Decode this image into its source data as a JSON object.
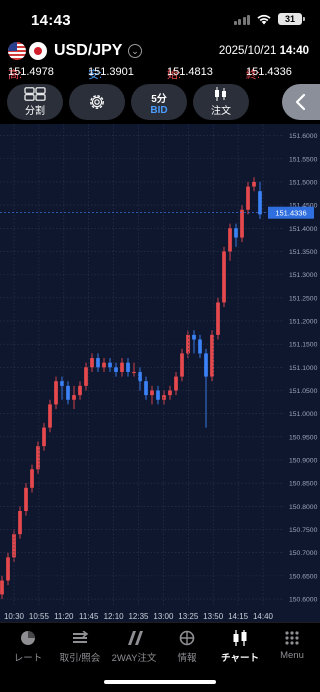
{
  "status": {
    "time": "14:43",
    "battery": "31"
  },
  "pair": {
    "symbol": "USD/JPY",
    "date": "2025/10/21",
    "time": "14:40",
    "high_label": "高:",
    "high": "151.4978",
    "low_label": "安:",
    "low": "151.3901",
    "open_label": "始:",
    "open": "151.4813",
    "close_label": "終:",
    "close": "151.4336"
  },
  "toolbar": {
    "split_label": "分割",
    "interval": "5分",
    "price_side": "BID",
    "order_label": "注文"
  },
  "chart_data": {
    "type": "candlestick",
    "interval": "5分",
    "price_side": "BID",
    "last_price": "151.4336",
    "y_ticks": [
      "151.6000",
      "151.5500",
      "151.5000",
      "151.4500",
      "151.4000",
      "151.3500",
      "151.3000",
      "151.2500",
      "151.2000",
      "151.1500",
      "151.1000",
      "151.0500",
      "151.0000",
      "150.9500",
      "150.9000",
      "150.8500",
      "150.8000",
      "150.7500",
      "150.7000",
      "150.6500",
      "150.6000"
    ],
    "ylim": [
      150.585,
      151.625
    ],
    "x_ticks": [
      "10:30",
      "10:55",
      "11:20",
      "11:45",
      "12:10",
      "12:35",
      "13:00",
      "13:25",
      "13:50",
      "14:15",
      "14:40"
    ],
    "colors": {
      "up": "#e5484d",
      "down": "#3b82f6",
      "grid": "#2a3552",
      "background": "#0f172e"
    },
    "candles": [
      [
        150.61,
        150.64,
        150.6,
        150.65
      ],
      [
        150.64,
        150.69,
        150.63,
        150.7
      ],
      [
        150.69,
        150.74,
        150.68,
        150.75
      ],
      [
        150.74,
        150.79,
        150.73,
        150.8
      ],
      [
        150.79,
        150.84,
        150.78,
        150.85
      ],
      [
        150.84,
        150.88,
        150.83,
        150.89
      ],
      [
        150.88,
        150.93,
        150.87,
        150.94
      ],
      [
        150.93,
        150.97,
        150.92,
        150.98
      ],
      [
        150.97,
        151.02,
        150.96,
        151.03
      ],
      [
        151.02,
        151.07,
        151.01,
        151.08
      ],
      [
        151.07,
        151.06,
        151.03,
        151.08
      ],
      [
        151.06,
        151.03,
        151.02,
        151.07
      ],
      [
        151.03,
        151.04,
        151.01,
        151.06
      ],
      [
        151.04,
        151.06,
        151.03,
        151.07
      ],
      [
        151.06,
        151.1,
        151.05,
        151.11
      ],
      [
        151.1,
        151.12,
        151.09,
        151.13
      ],
      [
        151.12,
        151.1,
        151.09,
        151.13
      ],
      [
        151.1,
        151.11,
        151.09,
        151.12
      ],
      [
        151.11,
        151.1,
        151.09,
        151.12
      ],
      [
        151.1,
        151.09,
        151.08,
        151.11
      ],
      [
        151.09,
        151.11,
        151.08,
        151.12
      ],
      [
        151.11,
        151.09,
        151.08,
        151.12
      ],
      [
        151.09,
        151.09,
        151.08,
        151.11
      ],
      [
        151.09,
        151.07,
        151.05,
        151.1
      ],
      [
        151.07,
        151.04,
        151.03,
        151.08
      ],
      [
        151.04,
        151.05,
        151.02,
        151.06
      ],
      [
        151.05,
        151.03,
        151.02,
        151.06
      ],
      [
        151.03,
        151.04,
        151.02,
        151.05
      ],
      [
        151.04,
        151.05,
        151.03,
        151.06
      ],
      [
        151.05,
        151.08,
        151.04,
        151.09
      ],
      [
        151.08,
        151.13,
        151.07,
        151.14
      ],
      [
        151.13,
        151.17,
        151.12,
        151.18
      ],
      [
        151.17,
        151.16,
        151.13,
        151.18
      ],
      [
        151.16,
        151.13,
        151.12,
        151.17
      ],
      [
        151.13,
        151.08,
        150.97,
        151.14
      ],
      [
        151.08,
        151.17,
        151.07,
        151.18
      ],
      [
        151.17,
        151.24,
        151.16,
        151.25
      ],
      [
        151.24,
        151.35,
        151.23,
        151.36
      ],
      [
        151.35,
        151.4,
        151.33,
        151.41
      ],
      [
        151.4,
        151.38,
        151.36,
        151.41
      ],
      [
        151.38,
        151.44,
        151.37,
        151.45
      ],
      [
        151.44,
        151.49,
        151.43,
        151.5
      ],
      [
        151.49,
        151.5,
        151.48,
        151.51
      ],
      [
        151.48,
        151.43,
        151.42,
        151.5
      ]
    ]
  },
  "tabs": [
    {
      "label": "レート"
    },
    {
      "label": "取引/照会"
    },
    {
      "label": "2WAY注文"
    },
    {
      "label": "情報"
    },
    {
      "label": "チャート"
    },
    {
      "label": "Menu"
    }
  ]
}
